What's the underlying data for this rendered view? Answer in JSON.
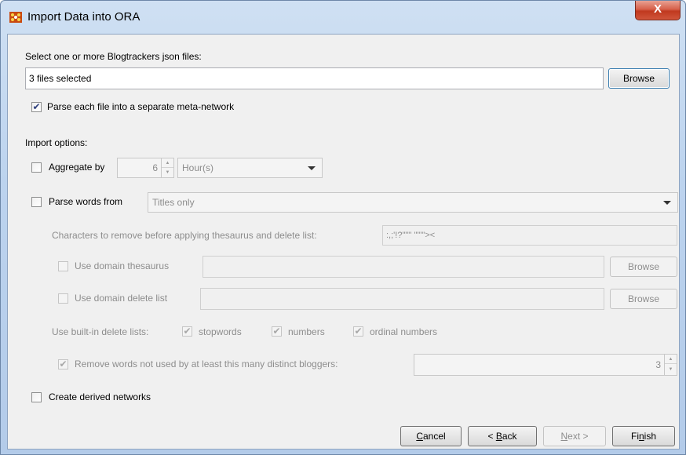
{
  "window": {
    "title": "Import Data into ORA",
    "close_glyph": "X"
  },
  "files": {
    "label": "Select one or more Blogtrackers json files:",
    "value": "3 files selected",
    "browse_label": "Browse"
  },
  "separate_meta_network": {
    "label": "Parse each file into a separate meta-network",
    "checked": true
  },
  "import_options_label": "Import options:",
  "aggregate": {
    "label": "Aggregate by",
    "checked": false,
    "amount": "6",
    "unit": "Hour(s)"
  },
  "parse_words": {
    "label": "Parse words from",
    "checked": false,
    "source": "Titles only"
  },
  "chars_remove": {
    "label": "Characters to remove before applying thesaurus and delete list:",
    "value": ":,;'!?\"\"'' \"\"\"'><"
  },
  "domain_thesaurus": {
    "label": "Use domain thesaurus",
    "value": "",
    "browse_label": "Browse"
  },
  "domain_delete_list": {
    "label": "Use domain delete list",
    "value": "",
    "browse_label": "Browse"
  },
  "builtin_delete": {
    "label": "Use built-in delete lists:",
    "options": [
      "stopwords",
      "numbers",
      "ordinal numbers"
    ]
  },
  "min_bloggers": {
    "label": "Remove words not used by at least this many distinct bloggers:",
    "value": "3"
  },
  "derived_networks": {
    "label": "Create derived networks",
    "checked": false
  },
  "footer": {
    "cancel": {
      "pre": "",
      "mnemonic": "C",
      "post": "ancel"
    },
    "back": {
      "pre": "< ",
      "mnemonic": "B",
      "post": "ack"
    },
    "next": {
      "pre": "",
      "mnemonic": "N",
      "post": "ext >"
    },
    "finish": {
      "pre": "Fi",
      "mnemonic": "n",
      "post": "ish"
    }
  },
  "colors": {
    "checkmark": "#2d3e7c",
    "close_red": "#c0391f",
    "titlebar": "#bcd3ee"
  }
}
